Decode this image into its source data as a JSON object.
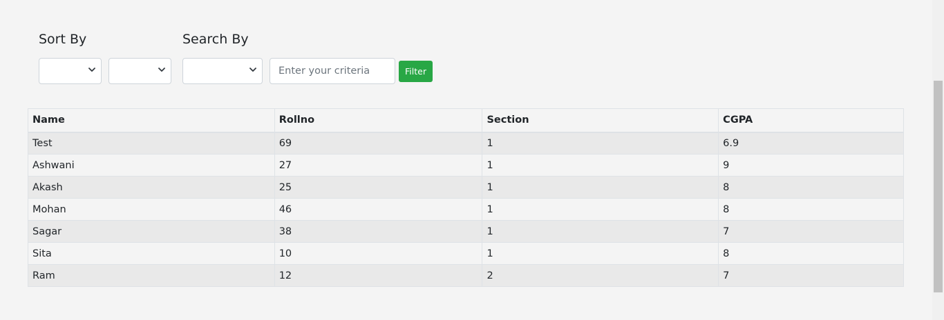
{
  "sort": {
    "title": "Sort By",
    "field_value": "",
    "order_value": ""
  },
  "search": {
    "title": "Search By",
    "field_value": "",
    "placeholder": "Enter your criteria",
    "value": "",
    "button_label": "Filter"
  },
  "colors": {
    "filter_button": "#28a745",
    "background": "#f4f4f4",
    "stripe": "#e9e9e9"
  },
  "table": {
    "headers": [
      "Name",
      "Rollno",
      "Section",
      "CGPA"
    ],
    "rows": [
      [
        "Test",
        "69",
        "1",
        "6.9"
      ],
      [
        "Ashwani",
        "27",
        "1",
        "9"
      ],
      [
        "Akash",
        "25",
        "1",
        "8"
      ],
      [
        "Mohan",
        "46",
        "1",
        "8"
      ],
      [
        "Sagar",
        "38",
        "1",
        "7"
      ],
      [
        "Sita",
        "10",
        "1",
        "8"
      ],
      [
        "Ram",
        "12",
        "2",
        "7"
      ]
    ]
  }
}
